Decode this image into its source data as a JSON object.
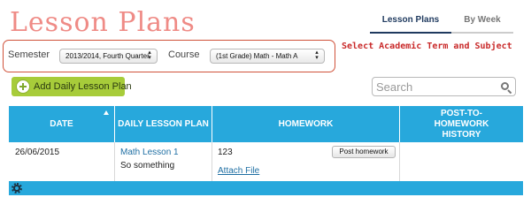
{
  "page": {
    "title": "Lesson Plans"
  },
  "tabs": [
    {
      "label": "Lesson Plans",
      "active": true
    },
    {
      "label": "By Week",
      "active": false
    }
  ],
  "filters": {
    "semester_label": "Semester",
    "semester_value": "2013/2014, Fourth Quarter",
    "course_label": "Course",
    "course_value": "(1st Grade) Math - Math A"
  },
  "annotation": "Select Academic Term and Subject",
  "toolbar": {
    "add_label": "Add Daily Lesson Plan",
    "search_placeholder": "Search"
  },
  "table": {
    "headers": [
      "DATE",
      "DAILY LESSON PLAN",
      "HOMEWORK",
      "POST-TO-HOMEWORK HISTORY"
    ],
    "rows": [
      {
        "date": "26/06/2015",
        "lesson_link": "Math Lesson 1",
        "lesson_desc": "So something",
        "homework": "123",
        "post_button": "Post homework",
        "attach_link": "Attach File",
        "history": ""
      }
    ]
  },
  "colors": {
    "title": "#ef8b86",
    "table_header": "#27a8dc",
    "add_button": "#a7cc3a",
    "annotation": "#c92a2a",
    "filter_border": "#d0523a"
  },
  "icons": [
    "plus-circle-icon",
    "search-icon",
    "sort-asc-icon",
    "gear-icon",
    "select-arrows-icon"
  ]
}
